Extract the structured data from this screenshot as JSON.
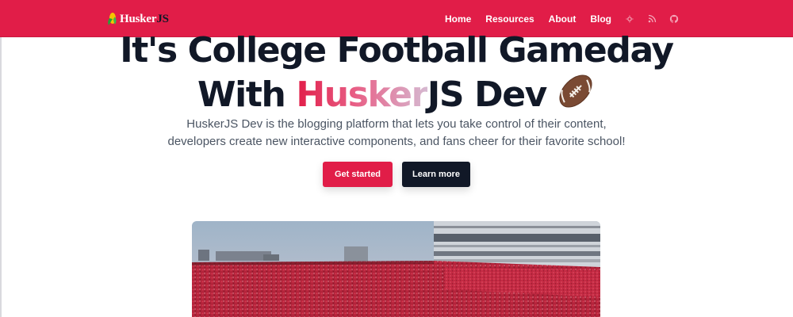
{
  "navbar": {
    "brand_main": "Husker",
    "brand_accent": "JS",
    "links": [
      "Home",
      "Resources",
      "About",
      "Blog"
    ],
    "icons": [
      "theme-toggle-icon",
      "rss-icon",
      "github-icon"
    ]
  },
  "hero": {
    "title_line1": "It's College Football Gameday",
    "title_with": "With ",
    "title_highlight": "Husker",
    "title_highlight2": "JS Dev",
    "subtitle_line1": "HuskerJS Dev is the blogging platform that lets you take control of their content,",
    "subtitle_line2": "developers create new interactive components, and fans cheer for their favorite school!",
    "primary_button": "Get started",
    "secondary_button": "Learn more"
  },
  "colors": {
    "brand": "#e11d48",
    "dark": "#111827",
    "muted": "#4b5563"
  }
}
